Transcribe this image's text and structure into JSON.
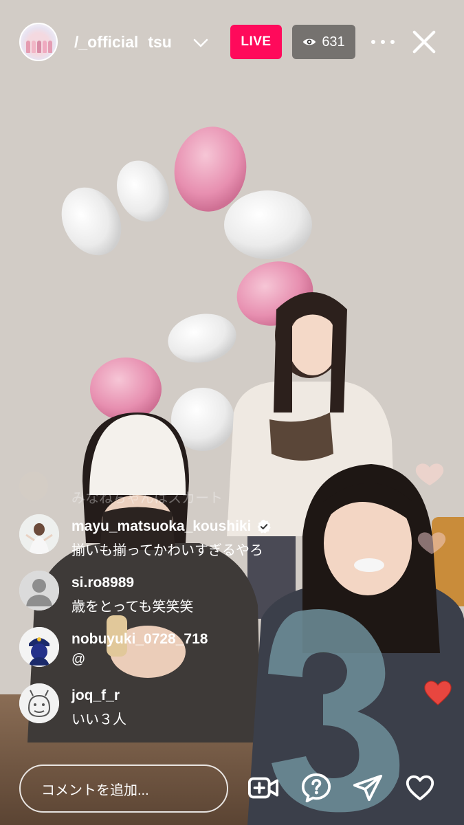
{
  "header": {
    "account_name": "/_official",
    "account_suffix": "tsu",
    "live_label": "LIVE",
    "viewer_count": "631",
    "live_color": "#ff0a5b"
  },
  "comments": [
    {
      "username": "",
      "text": "みなねちゃんはスカート",
      "faded": true
    },
    {
      "username": "mayu_matsuoka_koushiki",
      "text": "揃いも揃ってかわいすぎるやろ",
      "verified": true
    },
    {
      "username": "si.ro8989",
      "text": "歳をとっても笑笑笑"
    },
    {
      "username": "nobuyuki_0728_718",
      "text": "@"
    },
    {
      "username": "joq_f_r",
      "text": "いい３人"
    }
  ],
  "footer": {
    "comment_placeholder": "コメントを追加...",
    "icons": [
      "add-video-icon",
      "question-icon",
      "send-icon",
      "heart-icon"
    ]
  }
}
